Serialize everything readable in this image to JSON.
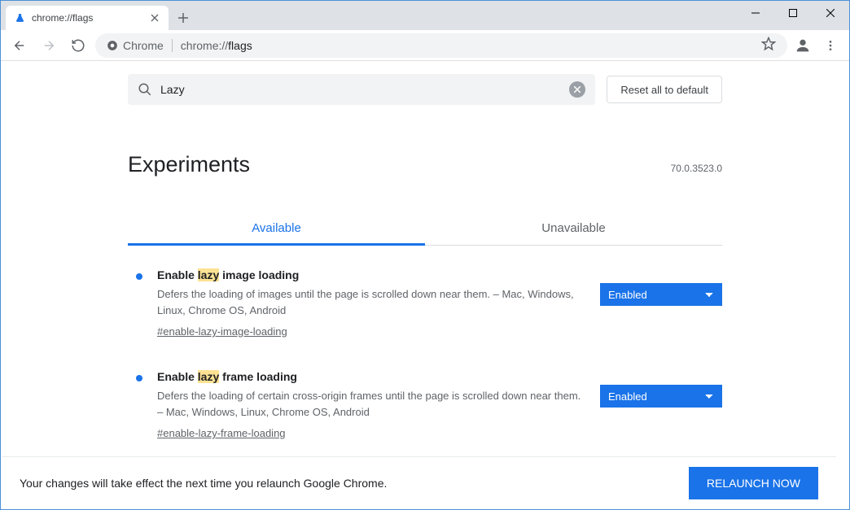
{
  "window": {
    "tab_title": "chrome://flags"
  },
  "toolbar": {
    "chrome_label": "Chrome",
    "url_scheme": "chrome://",
    "url_path": "flags"
  },
  "search": {
    "value": "Lazy",
    "reset_label": "Reset all to default"
  },
  "header": {
    "title": "Experiments",
    "version": "70.0.3523.0"
  },
  "tabs": {
    "available": "Available",
    "unavailable": "Unavailable"
  },
  "flags": [
    {
      "title_pre": "Enable ",
      "title_hl": "lazy",
      "title_post": " image loading",
      "desc": "Defers the loading of images until the page is scrolled down near them. – Mac, Windows, Linux, Chrome OS, Android",
      "hash": "#enable-lazy-image-loading",
      "state": "Enabled"
    },
    {
      "title_pre": "Enable ",
      "title_hl": "lazy",
      "title_post": " frame loading",
      "desc": "Defers the loading of certain cross-origin frames until the page is scrolled down near them. – Mac, Windows, Linux, Chrome OS, Android",
      "hash": "#enable-lazy-frame-loading",
      "state": "Enabled"
    }
  ],
  "relaunch": {
    "msg": "Your changes will take effect the next time you relaunch Google Chrome.",
    "btn": "RELAUNCH NOW"
  }
}
